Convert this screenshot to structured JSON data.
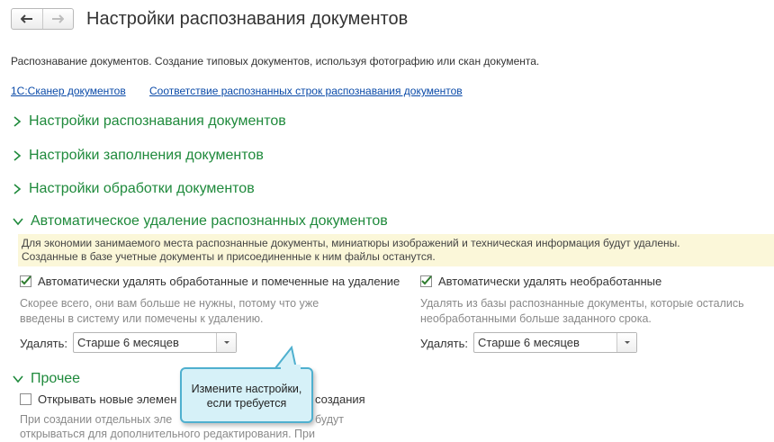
{
  "window": {
    "title": "Настройки распознавания документов"
  },
  "nav": {
    "back_icon": "arrow-left-icon",
    "forward_icon": "arrow-right-icon"
  },
  "description": "Распознавание документов. Создание типовых документов, используя фотографию или скан документа.",
  "links": [
    {
      "label": "1С:Сканер документов"
    },
    {
      "label": "Соответствие распознанных строк распознавания документов"
    }
  ],
  "sections": {
    "recognition": "Настройки распознавания документов",
    "filling": "Настройки заполнения документов",
    "processing": "Настройки обработки документов",
    "auto_delete": "Автоматическое удаление распознанных документов",
    "other": "Прочее"
  },
  "auto_delete": {
    "info_line1": "Для экономии занимаемого места распознанные документы, миниатюры изображений и техническая информация будут удалены.",
    "info_line2": "Созданные в базе учетные документы и присоединенные к ним файлы останутся.",
    "left": {
      "checkbox_label": "Автоматически удалять обработанные и помеченные на удаление",
      "checked": true,
      "hint_line1": "Скорее всего, они вам больше не нужны, потому что уже",
      "hint_line2": "введены в систему или помечены к удалению.",
      "delete_label": "Удалять:",
      "delete_value": "Старше 6 месяцев"
    },
    "right": {
      "checkbox_label": "Автоматически удалять необработанные",
      "checked": true,
      "hint_line1": "Удалять из базы распознанные документы, которые остались",
      "hint_line2": "необработанными больше заданного срока.",
      "delete_label": "Удалять:",
      "delete_value": "Старше 6 месяцев"
    }
  },
  "other": {
    "checkbox_label_part1": "Открывать новые элемен",
    "checkbox_label_part2": "создания",
    "checked": false,
    "hint_line1_part1": "При создании отдельных эле",
    "hint_line1_part2": "будут",
    "hint_line2": "открываться для дополнительного редактирования. При"
  },
  "tooltip": {
    "line1": "Измените настройки,",
    "line2": "если требуется"
  },
  "colors": {
    "section_green": "#1f8a3c",
    "link_blue": "#0a4aa8",
    "info_bg": "#fbf7d9",
    "tooltip_bg": "#d6f1f8"
  }
}
